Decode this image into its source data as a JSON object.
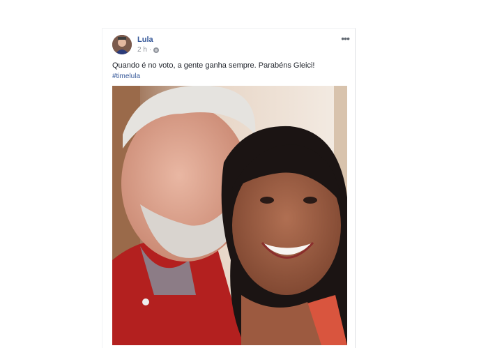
{
  "post": {
    "author": "Lula",
    "time": "2 h",
    "separator": "·",
    "more_label": "•••",
    "text": "Quando é no voto, a gente ganha sempre. Parabéns Gleici!",
    "hashtag": "#timelula"
  },
  "icons": {
    "avatar": "profile-photo",
    "privacy": "globe-icon",
    "more": "more-options-icon"
  },
  "colors": {
    "link": "#365899",
    "meta": "#90949c",
    "text": "#1d2129"
  }
}
